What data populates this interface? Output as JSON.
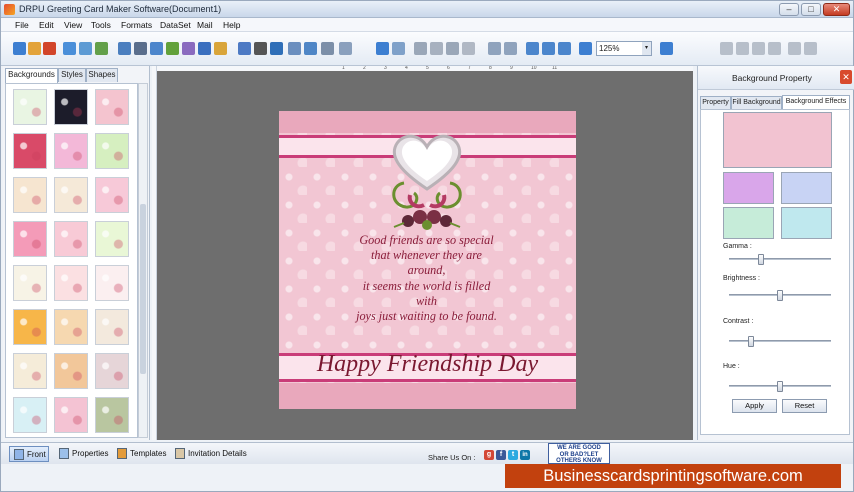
{
  "window": {
    "title": "DRPU Greeting Card Maker Software(Document1)",
    "controls": {
      "minimize": "–",
      "maximize": "□",
      "close": "✕"
    }
  },
  "menu": [
    "File",
    "Edit",
    "View",
    "Tools",
    "Formats",
    "DataSet",
    "Mail",
    "Help"
  ],
  "toolbar": {
    "zoom": "125%",
    "zoom_dropdown": "▾",
    "icons": [
      "new-icon",
      "open-icon",
      "close-icon",
      "save-icon",
      "save-as-icon",
      "export-icon",
      "print-preview-icon",
      "print-icon",
      "copy-icon",
      "image-icon",
      "signature-icon",
      "pen-icon",
      "shape-icon",
      "word-art-icon",
      "barcode-icon",
      "text-icon",
      "picture-icon",
      "rectangle-icon",
      "page-icon",
      "page-setup-icon",
      "undo-icon",
      "redo-icon",
      "cut-icon",
      "copy-doc-icon",
      "paste-icon",
      "delete-icon",
      "align-left-icon",
      "align-right-icon",
      "grid-icon",
      "fit-icon",
      "center-icon",
      "zoom-in-icon",
      "zoom-out-icon",
      "lock-icon",
      "unlock-icon",
      "arrow-left-icon",
      "arrow-right-icon",
      "arrow-up-icon",
      "arrow-down-icon"
    ]
  },
  "ruler": {
    "ticks": [
      "1",
      "2",
      "3",
      "4",
      "5",
      "6",
      "7",
      "8",
      "9",
      "10",
      "11"
    ]
  },
  "left_panel": {
    "tabs": [
      "Backgrounds",
      "Styles",
      "Shapes"
    ],
    "active_tab": "Backgrounds",
    "thumbnails": [
      "#e9f5e3",
      "#1c1c2a",
      "#f4c4cf",
      "#d94a68",
      "#f3b8d8",
      "#d6efc0",
      "#f6e5d0",
      "#f5e9d8",
      "#f7c9d8",
      "#f49bb8",
      "#f8cad6",
      "#e9f7d6",
      "#f7f3e6",
      "#fbe0e2",
      "#fbeff0",
      "#f7b649",
      "#f6d8b0",
      "#f3e9dd",
      "#f5ecd9",
      "#f2c79a",
      "#e6d5d8",
      "#d8f0f5",
      "#f4c3d3",
      "#b9c6a0"
    ]
  },
  "card": {
    "message_lines": [
      "Good friends are so special",
      "that whenever they are",
      "around,",
      "it seems the world is filled",
      "with",
      "joys just waiting to be found."
    ],
    "headline": "Happy Friendship Day"
  },
  "right_panel": {
    "title": "Background Property",
    "close": "✕",
    "tabs": [
      "Property",
      "Fill Background",
      "Background Effects"
    ],
    "active_tab": "Background Effects",
    "preview_color": "#f2c3d1",
    "swatch_colors": [
      "#d9a6ea",
      "#c8d3f4",
      "#c6ecd9",
      "#bfe8ee"
    ],
    "sliders": [
      {
        "label": "Gamma :",
        "value": 0.3
      },
      {
        "label": "Brightness :",
        "value": 0.5
      },
      {
        "label": "Contrast :",
        "value": 0.2
      },
      {
        "label": "Hue :",
        "value": 0.5
      }
    ],
    "buttons": {
      "apply": "Apply",
      "reset": "Reset"
    }
  },
  "bottom_bar": {
    "buttons": [
      "Front",
      "Properties",
      "Templates",
      "Invitation Details"
    ],
    "active": "Front",
    "share_label": "Share Us On :",
    "social": [
      "g",
      "f",
      "t",
      "in"
    ],
    "badge_lines": [
      "WE ARE GOOD",
      "OR BAD?LET",
      "OTHERS KNOW"
    ]
  },
  "watermark": "Businesscardsprintingsoftware.com",
  "colors": {
    "card_pink": "#f2c6d3",
    "card_stripe": "#c93c78",
    "text_maroon": "#8a1d3a",
    "watermark_bg": "#c2410e"
  }
}
